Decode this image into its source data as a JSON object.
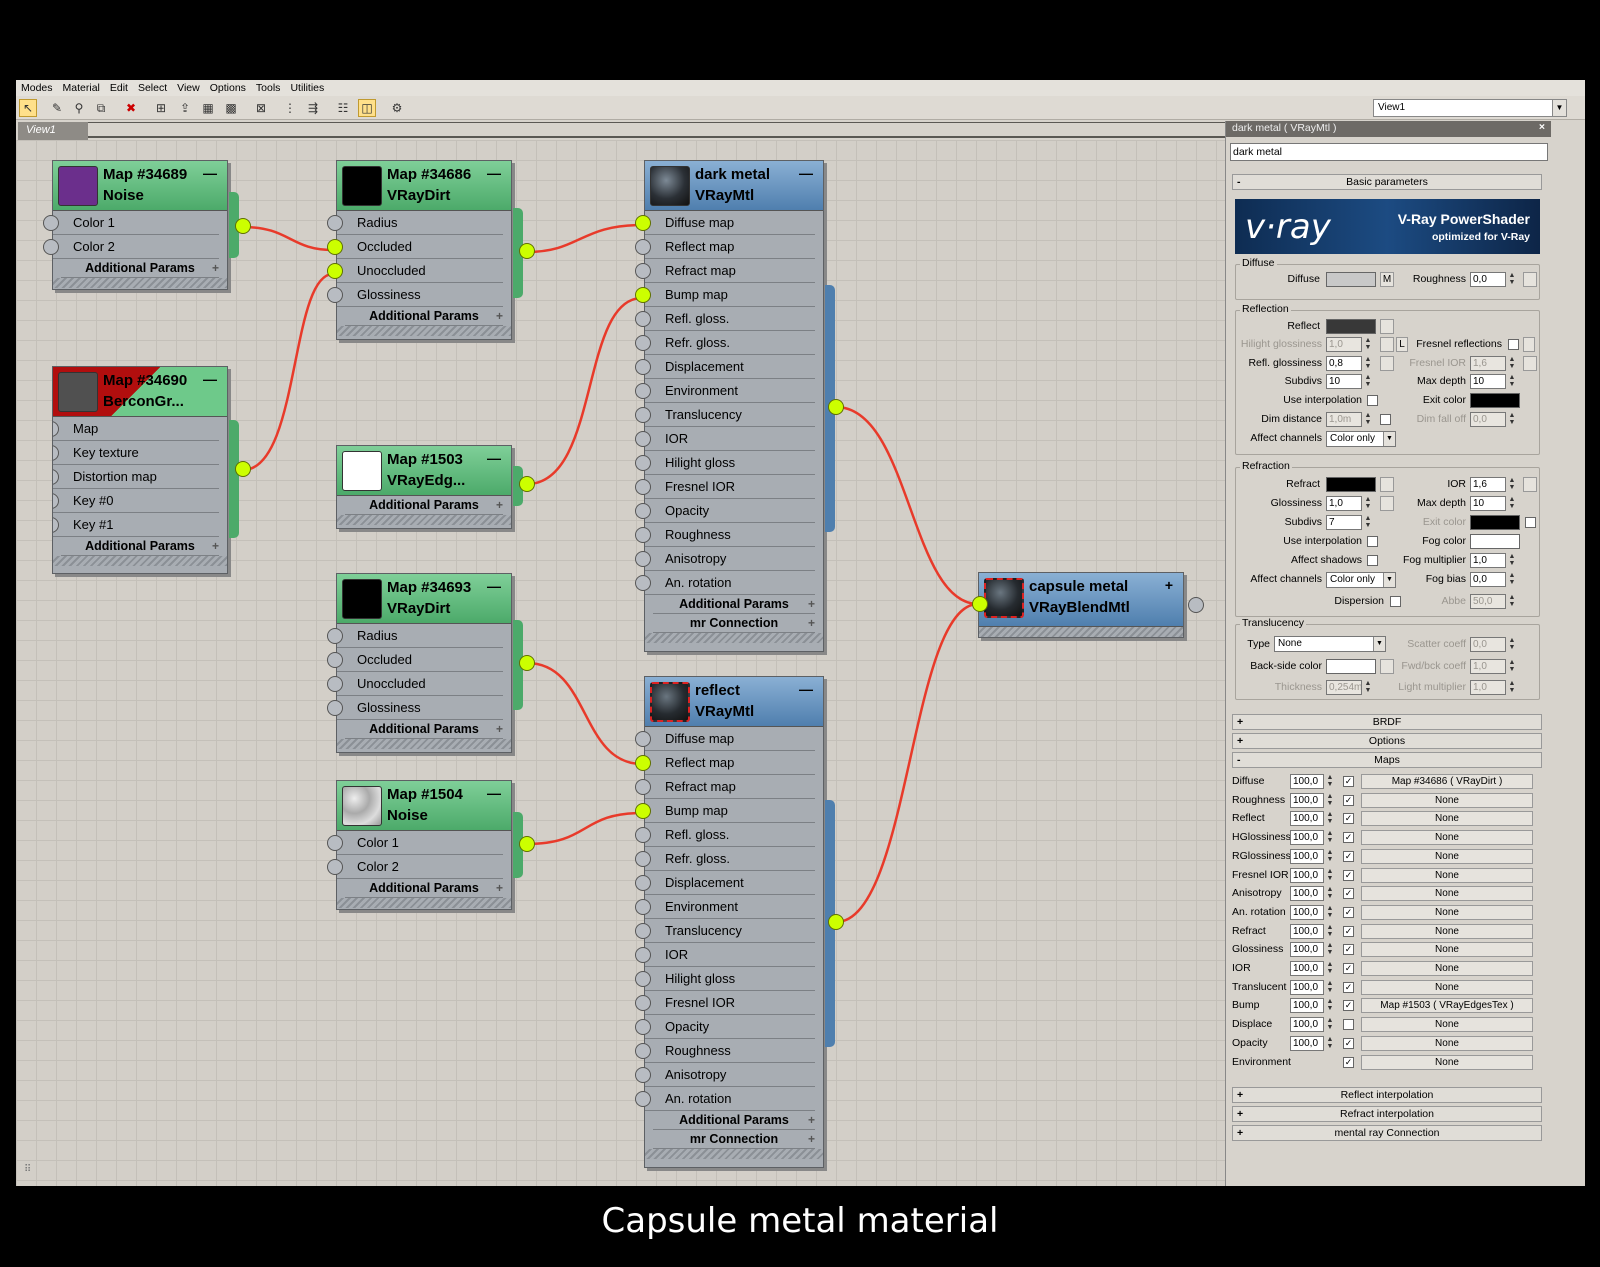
{
  "menu": [
    "Modes",
    "Material",
    "Edit",
    "Select",
    "View",
    "Options",
    "Tools",
    "Utilities"
  ],
  "toolbar": {
    "icons": [
      "select-arrow-icon",
      "eyedropper-icon",
      "pick-material-icon",
      "put-to-scene-icon",
      "delete-icon",
      "assign-icon",
      "move-children-icon",
      "layout-icon",
      "layout-children-icon",
      "hide-unused-icon",
      "show-map-icon",
      "show-end-result-icon",
      "hierarchy-icon",
      "background-icon",
      "options-icon"
    ],
    "view_select": "View1"
  },
  "tab": "View1",
  "nodes": {
    "n1": {
      "title": "Map #34689",
      "type": "Noise",
      "slots": [
        "Color 1",
        "Color 2"
      ],
      "footer": "Additional Params",
      "thumb": "#6b2f8c"
    },
    "n2": {
      "title": "Map #34690",
      "type": "BerconGr...",
      "slots": [
        "Map",
        "Key texture",
        "Distortion map",
        "Key #0",
        "Key #1"
      ],
      "footer": "Additional Params"
    },
    "n3": {
      "title": "Map #34686",
      "type": "VRayDirt",
      "slots": [
        "Radius",
        "Occluded",
        "Unoccluded",
        "Glossiness"
      ],
      "footer": "Additional Params"
    },
    "n4": {
      "title": "Map #1503",
      "type": "VRayEdg...",
      "footer": "Additional Params"
    },
    "n5": {
      "title": "Map #34693",
      "type": "VRayDirt",
      "slots": [
        "Radius",
        "Occluded",
        "Unoccluded",
        "Glossiness"
      ],
      "footer": "Additional Params"
    },
    "n6": {
      "title": "Map #1504",
      "type": "Noise",
      "slots": [
        "Color 1",
        "Color 2"
      ],
      "footer": "Additional Params"
    },
    "m1": {
      "title": "dark metal",
      "type": "VRayMtl",
      "slots": [
        "Diffuse map",
        "Reflect map",
        "Refract map",
        "Bump map",
        "Refl. gloss.",
        "Refr. gloss.",
        "Displacement",
        "Environment",
        "Translucency",
        "IOR",
        "Hilight gloss",
        "Fresnel IOR",
        "Opacity",
        "Roughness",
        "Anisotropy",
        "An. rotation"
      ],
      "footer1": "Additional Params",
      "footer2": "mr Connection"
    },
    "m2": {
      "title": "reflect",
      "type": "VRayMtl",
      "slots": [
        "Diffuse map",
        "Reflect map",
        "Refract map",
        "Bump map",
        "Refl. gloss.",
        "Refr. gloss.",
        "Displacement",
        "Environment",
        "Translucency",
        "IOR",
        "Hilight gloss",
        "Fresnel IOR",
        "Opacity",
        "Roughness",
        "Anisotropy",
        "An. rotation"
      ],
      "footer1": "Additional Params",
      "footer2": "mr Connection"
    },
    "blend": {
      "title": "capsule metal",
      "type": "VRayBlendMtl"
    }
  },
  "panel": {
    "title": "dark metal  ( VRayMtl )",
    "name": "dark metal",
    "basic": "Basic parameters",
    "banner": {
      "logo": "v·ray",
      "t1": "V-Ray PowerShader",
      "t2": "optimized for V-Ray"
    },
    "diffuse": {
      "group": "Diffuse",
      "label": "Diffuse",
      "m": "M",
      "rough_label": "Roughness",
      "rough": "0,0"
    },
    "reflection": {
      "group": "Reflection",
      "reflect": "Reflect",
      "hilight": "Hilight glossiness",
      "hilight_v": "1,0",
      "L": "L",
      "fresnel": "Fresnel reflections",
      "refl_gloss": "Refl. glossiness",
      "refl_gloss_v": "0,8",
      "fresnel_ior": "Fresnel IOR",
      "fresnel_ior_v": "1,6",
      "subdivs": "Subdivs",
      "subdivs_v": "10",
      "maxdepth": "Max depth",
      "maxdepth_v": "10",
      "use_interp": "Use interpolation",
      "exit": "Exit color",
      "dim_dist": "Dim distance",
      "dim_dist_v": "1,0m",
      "dim_fall": "Dim fall off",
      "dim_fall_v": "0,0",
      "affect": "Affect channels",
      "affect_v": "Color only"
    },
    "refraction": {
      "group": "Refraction",
      "refract": "Refract",
      "ior": "IOR",
      "ior_v": "1,6",
      "gloss": "Glossiness",
      "gloss_v": "1,0",
      "maxdepth": "Max depth",
      "maxdepth_v": "10",
      "subdivs": "Subdivs",
      "subdivs_v": "7",
      "exit": "Exit color",
      "use_interp": "Use interpolation",
      "fog": "Fog color",
      "aff_shadows": "Affect shadows",
      "fog_mult": "Fog multiplier",
      "fog_mult_v": "1,0",
      "affect": "Affect channels",
      "affect_v": "Color only",
      "fog_bias": "Fog bias",
      "fog_bias_v": "0,0",
      "dispersion": "Dispersion",
      "abbe": "Abbe",
      "abbe_v": "50,0"
    },
    "transl": {
      "group": "Translucency",
      "type": "Type",
      "type_v": "None",
      "scatter": "Scatter coeff",
      "scatter_v": "0,0",
      "back": "Back-side color",
      "fwd": "Fwd/bck coeff",
      "fwd_v": "1,0",
      "thick": "Thickness",
      "thick_v": "0,254m",
      "light": "Light multiplier",
      "light_v": "1,0"
    },
    "rollouts": [
      "BRDF",
      "Options",
      "Maps"
    ],
    "maps": [
      {
        "n": "Diffuse",
        "v": "100,0",
        "c": true,
        "m": "Map #34686  ( VRayDirt )"
      },
      {
        "n": "Roughness",
        "v": "100,0",
        "c": true,
        "m": "None"
      },
      {
        "n": "Reflect",
        "v": "100,0",
        "c": true,
        "m": "None"
      },
      {
        "n": "HGlossiness",
        "v": "100,0",
        "c": true,
        "m": "None"
      },
      {
        "n": "RGlossiness",
        "v": "100,0",
        "c": true,
        "m": "None"
      },
      {
        "n": "Fresnel IOR",
        "v": "100,0",
        "c": true,
        "m": "None"
      },
      {
        "n": "Anisotropy",
        "v": "100,0",
        "c": true,
        "m": "None"
      },
      {
        "n": "An. rotation",
        "v": "100,0",
        "c": true,
        "m": "None"
      },
      {
        "n": "Refract",
        "v": "100,0",
        "c": true,
        "m": "None"
      },
      {
        "n": "Glossiness",
        "v": "100,0",
        "c": true,
        "m": "None"
      },
      {
        "n": "IOR",
        "v": "100,0",
        "c": true,
        "m": "None"
      },
      {
        "n": "Translucent",
        "v": "100,0",
        "c": true,
        "m": "None"
      },
      {
        "n": "Bump",
        "v": "100,0",
        "c": true,
        "m": "Map #1503  ( VRayEdgesTex )"
      },
      {
        "n": "Displace",
        "v": "100,0",
        "c": false,
        "m": "None"
      },
      {
        "n": "Opacity",
        "v": "100,0",
        "c": true,
        "m": "None"
      },
      {
        "n": "Environment",
        "v": "",
        "c": true,
        "m": "None"
      }
    ],
    "bottom": [
      "Reflect interpolation",
      "Refract interpolation",
      "mental ray Connection"
    ]
  },
  "caption": "Capsule metal material"
}
